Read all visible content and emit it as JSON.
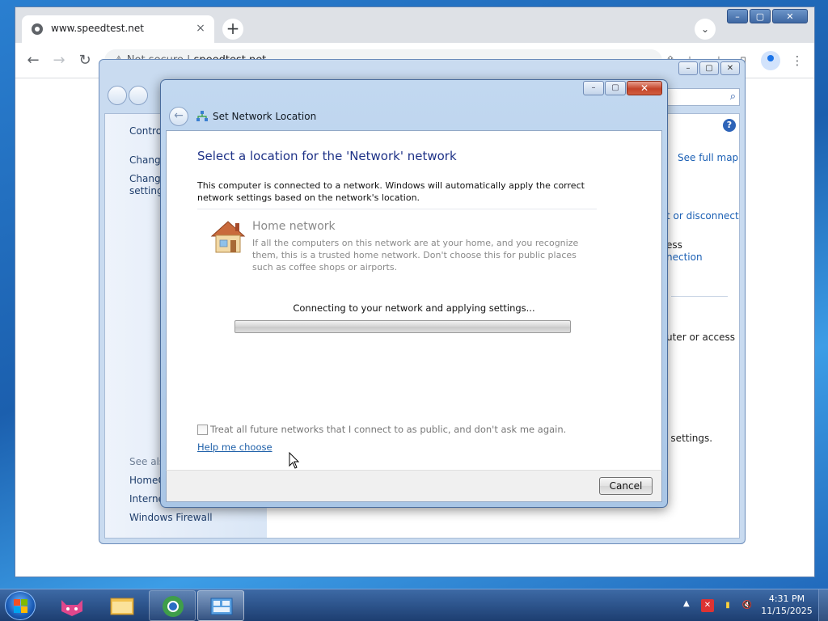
{
  "browser": {
    "tab_title": "www.speedtest.net",
    "tab_close": "×",
    "new_tab": "+",
    "omnibox_security": "Not secure",
    "omnibox_url": "speedtest.net"
  },
  "explorer": {
    "left_links": [
      "Control",
      "Change",
      "Change",
      "settings"
    ],
    "see_also_label": "See also",
    "see_also_links": [
      "HomeG",
      "Internet",
      "Windows Firewall"
    ],
    "right_links": {
      "see_full_map": "See full map",
      "connect_disconnect": "t or disconnect",
      "access": "ess",
      "connection": "nection",
      "computer_access": "uter or access",
      "settings": "g settings."
    }
  },
  "dialog": {
    "window_title": "Set Network Location",
    "heading": "Select a location for the 'Network' network",
    "intro": "This computer is connected to a network. Windows will automatically apply the correct network settings based on the network's location.",
    "option": {
      "title": "Home network",
      "description": "If all the computers on this network are at your home, and you recognize them, this is a trusted home network.  Don't choose this for public places such as coffee shops or airports."
    },
    "progress_label": "Connecting to your network and applying settings...",
    "progress_percent": 0,
    "checkbox_label": "Treat all future networks that I connect to as public, and don't ask me again.",
    "checkbox_checked": false,
    "help_link": "Help me choose",
    "cancel_label": "Cancel"
  },
  "taskbar": {
    "clock_time": "4:31 PM",
    "clock_date": "11/15/2025"
  },
  "colors": {
    "heading": "#1e3287",
    "link": "#1c5ea8",
    "desktop": "#1b5fae"
  }
}
